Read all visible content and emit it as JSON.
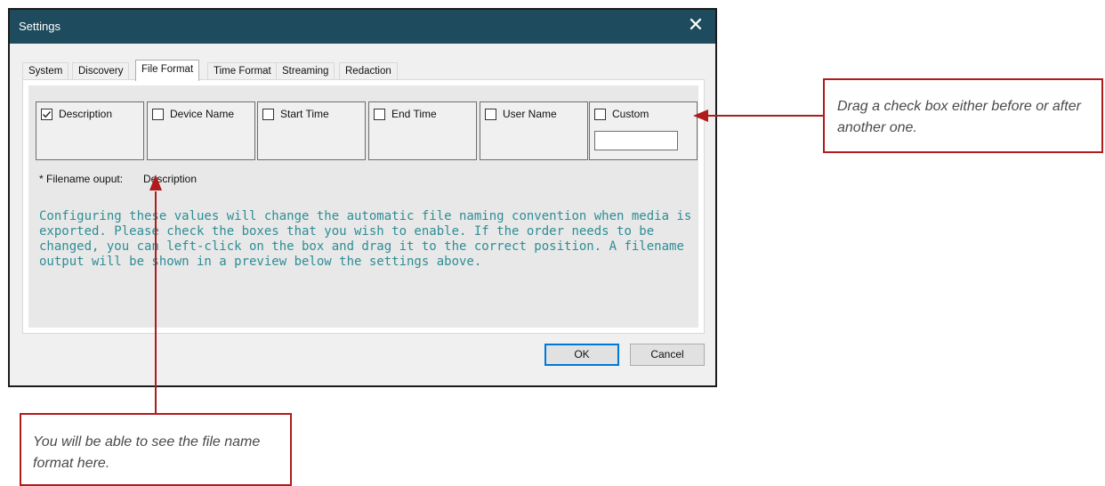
{
  "window": {
    "title": "Settings",
    "close_glyph": "✕"
  },
  "tabs": [
    {
      "label": "System"
    },
    {
      "label": "Discovery"
    },
    {
      "label": "File Format",
      "active": true
    },
    {
      "label": "Time Format"
    },
    {
      "label": "Streaming"
    },
    {
      "label": "Redaction"
    }
  ],
  "fields": [
    {
      "label": "Description",
      "checked": true
    },
    {
      "label": "Device Name",
      "checked": false
    },
    {
      "label": "Start Time",
      "checked": false
    },
    {
      "label": "End Time",
      "checked": false
    },
    {
      "label": "User Name",
      "checked": false
    },
    {
      "label": "Custom",
      "checked": false,
      "custom_value": ""
    }
  ],
  "filename_output": {
    "label": "* Filename ouput:",
    "value": "Description"
  },
  "info_text": "Configuring these values will change the automatic file naming convention when media is exported. Please check the boxes that you wish to enable. If the order needs to be changed, you can left-click on the box and drag it to the correct position. A filename output will be shown in a preview below the settings above.",
  "buttons": {
    "ok": "OK",
    "cancel": "Cancel"
  },
  "callouts": {
    "right": "Drag a check box either before or after another one.",
    "bottom": "You will be able to see the file name format here."
  },
  "colors": {
    "titlebar": "#1e4b5d",
    "callout_border": "#b01b1b",
    "info_text": "#2e8d95"
  },
  "icons": {
    "close": "close-icon",
    "check": "checkmark-icon",
    "arrow": "arrow-icon"
  }
}
